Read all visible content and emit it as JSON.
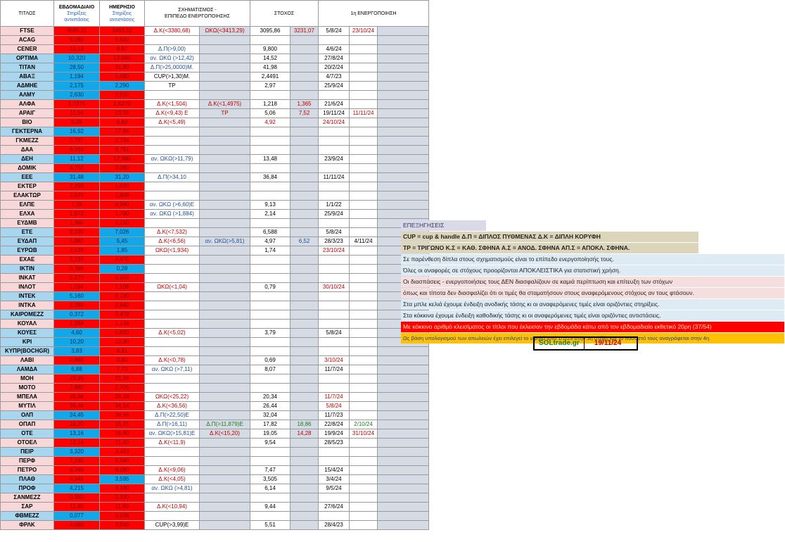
{
  "headers": {
    "ticker": "ΤΙΤΛΟΣ",
    "weekly": "ΕΒΔΟΜΑΔΙΑΙΟ",
    "daily": "ΗΜΕΡΗΣΙΟ",
    "sub_line1": "Στηρίξεις",
    "sub_line2": "αντιστάσεις",
    "pattern_line1": "ΣΧΗΜΑΤΙΣΜΟΣ -",
    "pattern_line2": "ΕΠΙΠΕΔΟ ΕΝΕΡΓΟΠΟΙΗΣΗΣ",
    "target": "ΣΤΟΧΟΣ",
    "activation": "1η ΕΝΕΡΓΟΠΟΙΗΣΗ"
  },
  "colors": {
    "red": "#ff0000",
    "blue": "#12a7e9",
    "pink": "#f7d7d7",
    "pale_blue": "#a9d6ef"
  },
  "rows": [
    {
      "t": "FTSE",
      "tbg": "pk",
      "w": "3595,31",
      "wc": "r",
      "d": "3493,62",
      "dc": "r",
      "p1": "Δ.Κ(<3380,68)",
      "p1c": "r",
      "p2": "ΩΚΩ(<3413,29)",
      "p2c": "r",
      "g1": "3095,86",
      "g2": "3231,07",
      "g2c": "r",
      "a1": "5/8/24",
      "a2": "23/10/24",
      "a2c": "r"
    },
    {
      "t": "ACAG",
      "tbg": "pk",
      "w": "6,080",
      "wc": "r",
      "d": "5,910",
      "dc": "r"
    },
    {
      "t": "CENER",
      "tbg": "pk",
      "w": "10,18",
      "wc": "r",
      "d": "9,87",
      "dc": "r",
      "p1": "Δ.Π(>9,00)",
      "p1c": "b",
      "g1": "9,800",
      "a1": "4/6/24"
    },
    {
      "t": "OPTIMA",
      "tbg": "bl",
      "w": "10,320",
      "wc": "b",
      "d": "13,060",
      "dc": "r",
      "p1": "αν. ΩΚΩ (>12,42)",
      "p1c": "b",
      "g1": "14,52",
      "a1": "27/8/24"
    },
    {
      "t": "TITAN",
      "tbg": "bl",
      "w": "28,50",
      "wc": "b",
      "d": "31,80",
      "dc": "r",
      "p1": "Δ.Π(>25,0000)Μ.",
      "p1c": "b",
      "g1": "41,98",
      "a1": "20/2/24"
    },
    {
      "t": "ΑΒΑΞ",
      "tbg": "bl",
      "w": "1,194",
      "wc": "b",
      "d": "1,480",
      "dc": "r",
      "p1": "CUP(>1,30)M.",
      "p1c": "n",
      "g1": "2,4491",
      "a1": "4/7/23"
    },
    {
      "t": "ΑΔΜΗΕ",
      "tbg": "bl",
      "w": "2,175",
      "wc": "b",
      "d": "2,290",
      "dc": "b",
      "p1": "TP",
      "p1c": "n",
      "g1": "2,97",
      "a1": "25/9/24"
    },
    {
      "t": "ΑΛΜΥ",
      "tbg": "bl",
      "w": "2,630",
      "wc": "b",
      "d": "2,910",
      "dc": "r"
    },
    {
      "t": "ΑΛΦΑ",
      "tbg": "pk",
      "w": "1,7375",
      "wc": "r",
      "d": "1,6270",
      "dc": "r",
      "p1": "Δ.Κ(<1,504)",
      "p1c": "r",
      "p2": "Δ.Κ(<1,4975)",
      "p2c": "r",
      "g1": "1,218",
      "g2": "1,365",
      "g2c": "r",
      "a1": "21/6/24"
    },
    {
      "t": "ΑΡΑΙΓ",
      "tbg": "pk",
      "w": "11,54",
      "wc": "r",
      "d": "10,59",
      "dc": "r",
      "p1": "Δ.Κ(<9,43) Ε",
      "p1c": "r",
      "p2": "TP",
      "p2c": "r",
      "g1": "5,06",
      "g2": "7,52",
      "g2c": "r",
      "a1": "19/11/24",
      "a2": "11/11/24",
      "a2c": "r"
    },
    {
      "t": "ΒΙΟ",
      "tbg": "pk",
      "w": "6,08",
      "wc": "r",
      "d": "5,82",
      "dc": "r",
      "p1": "Δ.Κ(<5,49)",
      "p1c": "r",
      "g1": "4,92",
      "g1c": "r",
      "a1": "24/10/24",
      "a1c": "r"
    },
    {
      "t": "ΓΕΚΤΕΡΝΑ",
      "tbg": "bl",
      "w": "16,92",
      "wc": "b",
      "d": "17,84",
      "dc": "r"
    },
    {
      "t": "ΓΚΜΕΖΖ",
      "tbg": "pk",
      "w": "0,797",
      "wc": "r",
      "d": "0,734",
      "dc": "r"
    },
    {
      "t": "ΔΑΑ",
      "tbg": "pk",
      "w": "8,056",
      "wc": "r",
      "d": "8,791",
      "dc": "r"
    },
    {
      "t": "ΔΕΗ",
      "tbg": "bl",
      "w": "11,12",
      "wc": "b",
      "d": "12,380",
      "dc": "r",
      "p1": "αν. ΩΚΩ(>11,79)",
      "p1c": "b",
      "g1": "13,48",
      "a1": "23/9/24"
    },
    {
      "t": "ΔΟΜΙΚ",
      "tbg": "pk",
      "w": "4,750",
      "wc": "r",
      "d": "3,080",
      "dc": "r"
    },
    {
      "t": "ΕΕΕ",
      "tbg": "bl",
      "w": "31,48",
      "wc": "b",
      "d": "31,20",
      "dc": "b",
      "p1": "Δ.Π(>34,10",
      "p1c": "b",
      "g1": "36,84",
      "a1": "11/11/24"
    },
    {
      "t": "ΕΚΤΕΡ",
      "tbg": "pk",
      "w": "2,290",
      "wc": "r",
      "d": "1,620",
      "dc": "r"
    },
    {
      "t": "ΕΛΑΚΤΩΡ",
      "tbg": "pk",
      "w": "2,670",
      "wc": "r",
      "d": "1,808",
      "dc": "r"
    },
    {
      "t": "ΕΛΠΕ",
      "tbg": "pk",
      "w": "7,28",
      "wc": "r",
      "d": "6,980",
      "dc": "r",
      "p1": "αν. ΩΚΩ (>6,60)Ε",
      "p1c": "b",
      "g1": "9,13",
      "a1": "1/1/22"
    },
    {
      "t": "ΕΛΧΑ",
      "tbg": "pk",
      "w": "1,972",
      "wc": "r",
      "d": "1,790",
      "dc": "r",
      "p1": "αν. ΩΚΩ (>1,884)",
      "p1c": "b",
      "g1": "2,14",
      "a1": "25/9/24"
    },
    {
      "t": "ΕΥΔΜΒ",
      "tbg": "pk",
      "w": "1,360",
      "wc": "r",
      "d": "1,210",
      "dc": "r"
    },
    {
      "t": "ΕΤΕ",
      "tbg": "bl",
      "w": "8,220",
      "wc": "r",
      "d": "7,026",
      "dc": "b",
      "p1": "Δ.Κ(<7,532)",
      "p1c": "r",
      "g1": "6,588",
      "a1": "5/8/24"
    },
    {
      "t": "ΕΥΔΑΠ",
      "tbg": "bl",
      "w": "5,880",
      "wc": "r",
      "d": "5,45",
      "dc": "b",
      "p1": "Δ.Κ(<6,56)",
      "p1c": "r",
      "p2": "αν. ΩΚΩ(>5,81)",
      "p2c": "b",
      "g1": "4,97",
      "g2": "6,52",
      "g2c": "b",
      "a1": "28/3/23",
      "a2": "4/11/24",
      "a2c": "n"
    },
    {
      "t": "ΕΥΡΩΒ",
      "tbg": "bl",
      "w": "2,128",
      "wc": "r",
      "d": "1,85",
      "dc": "b",
      "p1": "ΩΚΩ(<1,934)",
      "p1c": "r",
      "g1": "1,74",
      "a1": "23/10/24",
      "a1c": "r"
    },
    {
      "t": "ΕΧΑΕ",
      "tbg": "pk",
      "w": "5,130",
      "wc": "r",
      "d": "4,470",
      "dc": "r"
    },
    {
      "t": "IKTIN",
      "tbg": "bl",
      "w": "0,398",
      "wc": "r",
      "d": "0,28",
      "dc": "b"
    },
    {
      "t": "INKAT",
      "tbg": "pk",
      "w": "5,270",
      "wc": "r",
      "d": "4,956",
      "dc": "r"
    },
    {
      "t": "ΙΝΛΟΤ",
      "tbg": "pk",
      "w": "1,294",
      "wc": "r",
      "d": "1,108",
      "dc": "r",
      "p1": "ΩΚΩ(<1,04)",
      "p1c": "r",
      "g1": "0,79",
      "a1": "30/10/24",
      "a1c": "r"
    },
    {
      "t": "INTEK",
      "tbg": "bl",
      "w": "5,160",
      "wc": "b",
      "d": "6,130",
      "dc": "r"
    },
    {
      "t": "ΙΝΤΚΑ",
      "tbg": "pk",
      "w": "3,280",
      "wc": "r",
      "d": "2,840",
      "dc": "r"
    },
    {
      "t": "ΚΑΙΡΟΜΕΖΖ",
      "tbg": "bl",
      "w": "0,372",
      "wc": "b",
      "d": "0,479",
      "dc": "r"
    },
    {
      "t": "ΚΟΥΑΛ",
      "tbg": "pk",
      "w": "1,258",
      "wc": "r",
      "d": "1,134",
      "dc": "r"
    },
    {
      "t": "ΚΟΥΕΣ",
      "tbg": "bl",
      "w": "4,60",
      "wc": "b",
      "d": "5,830",
      "dc": "r",
      "p1": "Δ.Κ(<5,02)",
      "p1c": "r",
      "g1": "3,79",
      "a1": "5/8/24"
    },
    {
      "t": "ΚΡΙ",
      "tbg": "bl",
      "w": "10,20",
      "wc": "b",
      "d": "12,90",
      "dc": "r"
    },
    {
      "t": "ΚΥΠΡ(BOCHGR)",
      "tbg": "bl",
      "w": "3,83",
      "wc": "b",
      "d": "4,81",
      "dc": "r"
    },
    {
      "t": "ΛΑΒΙ",
      "tbg": "pk",
      "w": "0,865",
      "wc": "r",
      "d": "0,80",
      "dc": "r",
      "p1": "Δ.Κ(<0,78)",
      "p1c": "r",
      "g1": "0,69",
      "a1": "3/10/24",
      "a1c": "r"
    },
    {
      "t": "ΛΑΜΔΑ",
      "tbg": "bl",
      "w": "6,88",
      "wc": "b",
      "d": "7,73",
      "dc": "r",
      "p1": "αν. ΩΚΩ (>7,11)",
      "p1c": "b",
      "g1": "8,07",
      "a1": "11/7/24"
    },
    {
      "t": "ΜΟΗ",
      "tbg": "pk",
      "w": "23,96",
      "wc": "r",
      "d": "21,24",
      "dc": "r"
    },
    {
      "t": "ΜΟΤΟ",
      "tbg": "pk",
      "w": "2,880",
      "wc": "r",
      "d": "2,705",
      "dc": "r"
    },
    {
      "t": "ΜΠΕΛΑ",
      "tbg": "pk",
      "w": "26,68",
      "wc": "r",
      "d": "26,18",
      "dc": "r",
      "p1": "ΩΚΩ(<25,22)",
      "p1c": "r",
      "g1": "20,34",
      "a1": "11/7/24",
      "a1c": "r"
    },
    {
      "t": "ΜΥΤΙΛ",
      "tbg": "pk",
      "w": "36,44",
      "wc": "r",
      "d": "34,14",
      "dc": "r",
      "p1": "Δ.Κ(<36,56)",
      "p1c": "r",
      "g1": "26,44",
      "a1": "5/8/24",
      "a1c": "r"
    },
    {
      "t": "ΟΛΠ",
      "tbg": "bl",
      "w": "24,45",
      "wc": "b",
      "d": "26,55",
      "dc": "r",
      "p1": "Δ.Π(>22,50)Ε",
      "p1c": "b",
      "g1": "32,04",
      "a1": "11/7/23"
    },
    {
      "t": "ΟΠΑΠ",
      "tbg": "pk",
      "w": "16,20",
      "wc": "r",
      "d": "15,31",
      "dc": "r",
      "p1": "Δ.Π(>16,11)",
      "p1c": "b",
      "p2": "Δ.Π(>11,879)Ε",
      "p2c": "g",
      "g1": "17,82",
      "g2": "18,86",
      "g2c": "g",
      "a1": "22/8/24",
      "a1c": "n",
      "a2": "2/10/24",
      "a2c": "g"
    },
    {
      "t": "OTE",
      "tbg": "bl",
      "w": "13,16",
      "wc": "b",
      "d": "15,80",
      "dc": "r",
      "p1": "αν. ΩΚΩ(>15,81)Ε",
      "p1c": "b",
      "p2": "Δ.Κ(<15,20)",
      "p2c": "r",
      "g1": "19,05",
      "g2": "14,28",
      "g2c": "r",
      "a1": "19/9/24",
      "a2": "31/10/24",
      "a2c": "r"
    },
    {
      "t": "ΟΤΟΕΛ",
      "tbg": "pk",
      "w": "12,14",
      "wc": "r",
      "d": "11,40",
      "dc": "r",
      "p1": "Δ.Κ(<11,9)",
      "p1c": "r",
      "g1": "9,54",
      "a1": "28/5/23"
    },
    {
      "t": "ΠΕΙΡ",
      "tbg": "bl",
      "w": "3,320",
      "wc": "b",
      "d": "3,423",
      "dc": "r"
    },
    {
      "t": "ΠΕΡΦ",
      "tbg": "pk",
      "w": "7,240",
      "wc": "r",
      "d": "5,940",
      "dc": "r"
    },
    {
      "t": "ΠΕΤΡΟ",
      "tbg": "pk",
      "w": "8,340",
      "wc": "r",
      "d": "8,080",
      "dc": "r",
      "p1": "Δ.Κ(<9,06)",
      "p1c": "r",
      "g1": "7,47",
      "a1": "15/4/24"
    },
    {
      "t": "ΠΛΑΘ",
      "tbg": "bl",
      "w": "4,345",
      "wc": "r",
      "d": "3,595",
      "dc": "b",
      "p1": "Δ.Κ(<4,05)",
      "p1c": "r",
      "g1": "3,505",
      "a1": "3/4/24"
    },
    {
      "t": "ΠΡΟΦ",
      "tbg": "bl",
      "w": "4,215",
      "wc": "b",
      "d": "3,330",
      "dc": "r",
      "p1": "αν. ΩΚΩ (>4,81)",
      "p1c": "b",
      "g1": "6,14",
      "a1": "9/5/24"
    },
    {
      "t": "ΣΑΝΜΕΖΖ",
      "tbg": "pk",
      "w": "0,350",
      "wc": "r",
      "d": "0,320",
      "dc": "r"
    },
    {
      "t": "ΣΑΡ",
      "tbg": "pk",
      "w": "11,80",
      "wc": "r",
      "d": "11,60",
      "dc": "r",
      "p1": "Δ.Κ(<10,94)",
      "p1c": "r",
      "g1": "9,44",
      "a1": "27/6/24"
    },
    {
      "t": "ΦΒΜΕΖΖ",
      "tbg": "bl",
      "w": "0,077",
      "wc": "b",
      "d": "0,938",
      "dc": "r"
    },
    {
      "t": "ΦΡΛΚ",
      "tbg": "pk",
      "w": "4,090",
      "wc": "r",
      "d": "3,845",
      "dc": "r",
      "p1": "CUP(>3,99)Ε",
      "p1c": "n",
      "g1": "5,51",
      "a1": "28/4/23"
    }
  ],
  "notes": {
    "title": "ΕΠΕΞΗΓΗΣΕΙΣ",
    "line1": "CUP = cup & handle   Δ.Π = ΔΙΠΛΟΣ ΠΥΘΜΕΝΑΣ  Δ.Κ = ΔΙΠΛΗ ΚΟΡΥΦΗ",
    "line2": "TP = ΤΡΙΓΩΝΟ  Κ.Σ = ΚΑΘ. ΣΦΗΝΑ  Α.Σ = ΑΝΟΔ. ΣΦΗΝΑ  ΑΠ.Σ = ΑΠΟΚΛ. ΣΦΗΝΑ.",
    "line3": "Σε παρένθεση δίπλα στους σχηματισμούς είναι το επίπεδο ενεργοποίησής τους.",
    "line4": "Όλες οι αναφορές σε στόχους προορίζονται ΑΠΟΚΛΕΙΣΤΙΚΑ για  στατιστική χρήση.",
    "line5": "Οι διασπάσεις - ενεργοποιήσεις τους ΔΕΝ διασφαλίζουν σε καμιά περίπτωση και επίτευξη των στόχων",
    "line6": "όπως και τίποτα δεν διασφαλίζει ότι οι τιμές θα σταματήσουν στους αναφερόμενους στόχους αν τους φτάσουν.",
    "line7": "Στα μπλε κελιά έχουμε ένδειξη ανοδικής τάσης κι οι αναφερόμενες τιμές είναι οριζόντιες στηρίξεις.",
    "line8": "Στα κόκκινα έχουμε ένδειξη καθοδικής τάσης κι οι αναφερόμενες τιμές είναι οριζόντιες αντιστάσεις.",
    "line9": "Με κόκκινο αριθμό κλεισίματος οι τίτλοι που έκλεισαν την εβδομάδα κάτω από τον εβδομαδιαίο εκθετικό 20ρη (37/54)",
    "line10": "Ως βάση υπολογισμού των απωλειών έχει επιλεγεί το υψηλό από 1/1/23 στην 3η στήλη και το ποσοστό τους αναγράφεται στην 4η"
  },
  "brand": {
    "name": "SOLtrade.gr",
    "date": "19/11/24"
  }
}
